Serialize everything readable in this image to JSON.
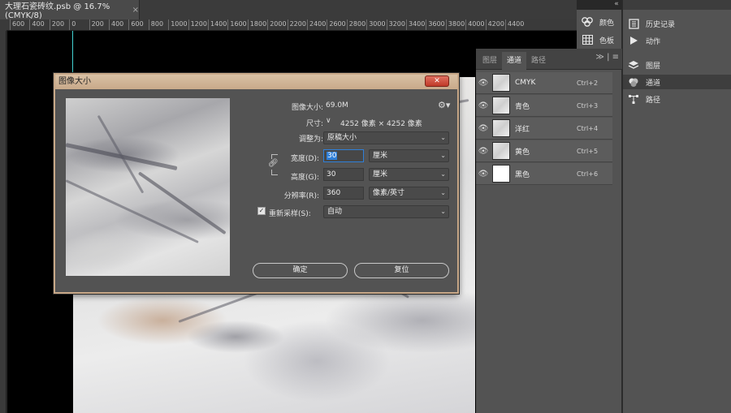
{
  "document": {
    "tab_title": "大理石瓷砖纹.psb @ 16.7%(CMYK/8)",
    "tab_close": "×"
  },
  "ruler": {
    "ticks": [
      "600",
      "400",
      "200",
      "0",
      "200",
      "400",
      "600",
      "800",
      "1000",
      "1200",
      "1400",
      "1600",
      "1800",
      "2000",
      "2200",
      "2400",
      "2600",
      "2800",
      "3000",
      "3200",
      "3400",
      "3600",
      "3800",
      "4000",
      "4200",
      "4400"
    ]
  },
  "dock": {
    "collapse": "«",
    "mid_items": [
      {
        "label": "颜色",
        "icon": "color-icon"
      },
      {
        "label": "色板",
        "icon": "swatches-icon"
      }
    ],
    "right_items": [
      {
        "label": "历史记录",
        "icon": "history-icon"
      },
      {
        "label": "动作",
        "icon": "play-icon"
      },
      {
        "label": "图层",
        "icon": "layers-icon"
      },
      {
        "label": "通道",
        "icon": "channels-icon",
        "active": true
      },
      {
        "label": "路径",
        "icon": "paths-icon"
      }
    ]
  },
  "channels_panel": {
    "tabs": [
      "图层",
      "通道",
      "路径"
    ],
    "active_tab": "通道",
    "menu": "≫ | ≡",
    "channels": [
      {
        "name": "CMYK",
        "shortcut": "Ctrl+2"
      },
      {
        "name": "青色",
        "shortcut": "Ctrl+3"
      },
      {
        "name": "洋红",
        "shortcut": "Ctrl+4"
      },
      {
        "name": "黄色",
        "shortcut": "Ctrl+5"
      },
      {
        "name": "黑色",
        "shortcut": "Ctrl+6"
      }
    ]
  },
  "dialog": {
    "title": "图像大小",
    "close": "✕",
    "image_size_label": "图像大小:",
    "image_size_value": "69.0M",
    "dimensions_label": "尺寸:",
    "dimensions_value": "4252 像素 × 4252 像素",
    "fit_to_label": "调整为:",
    "fit_to_value": "原稿大小",
    "width_label": "宽度(D):",
    "width_value": "30",
    "width_unit": "厘米",
    "height_label": "高度(G):",
    "height_value": "30",
    "height_unit": "厘米",
    "resolution_label": "分辨率(R):",
    "resolution_value": "360",
    "resolution_unit": "像素/英寸",
    "resample_label": "重新采样(S):",
    "resample_value": "自动",
    "resample_checked": true,
    "ok_label": "确定",
    "reset_label": "复位"
  }
}
